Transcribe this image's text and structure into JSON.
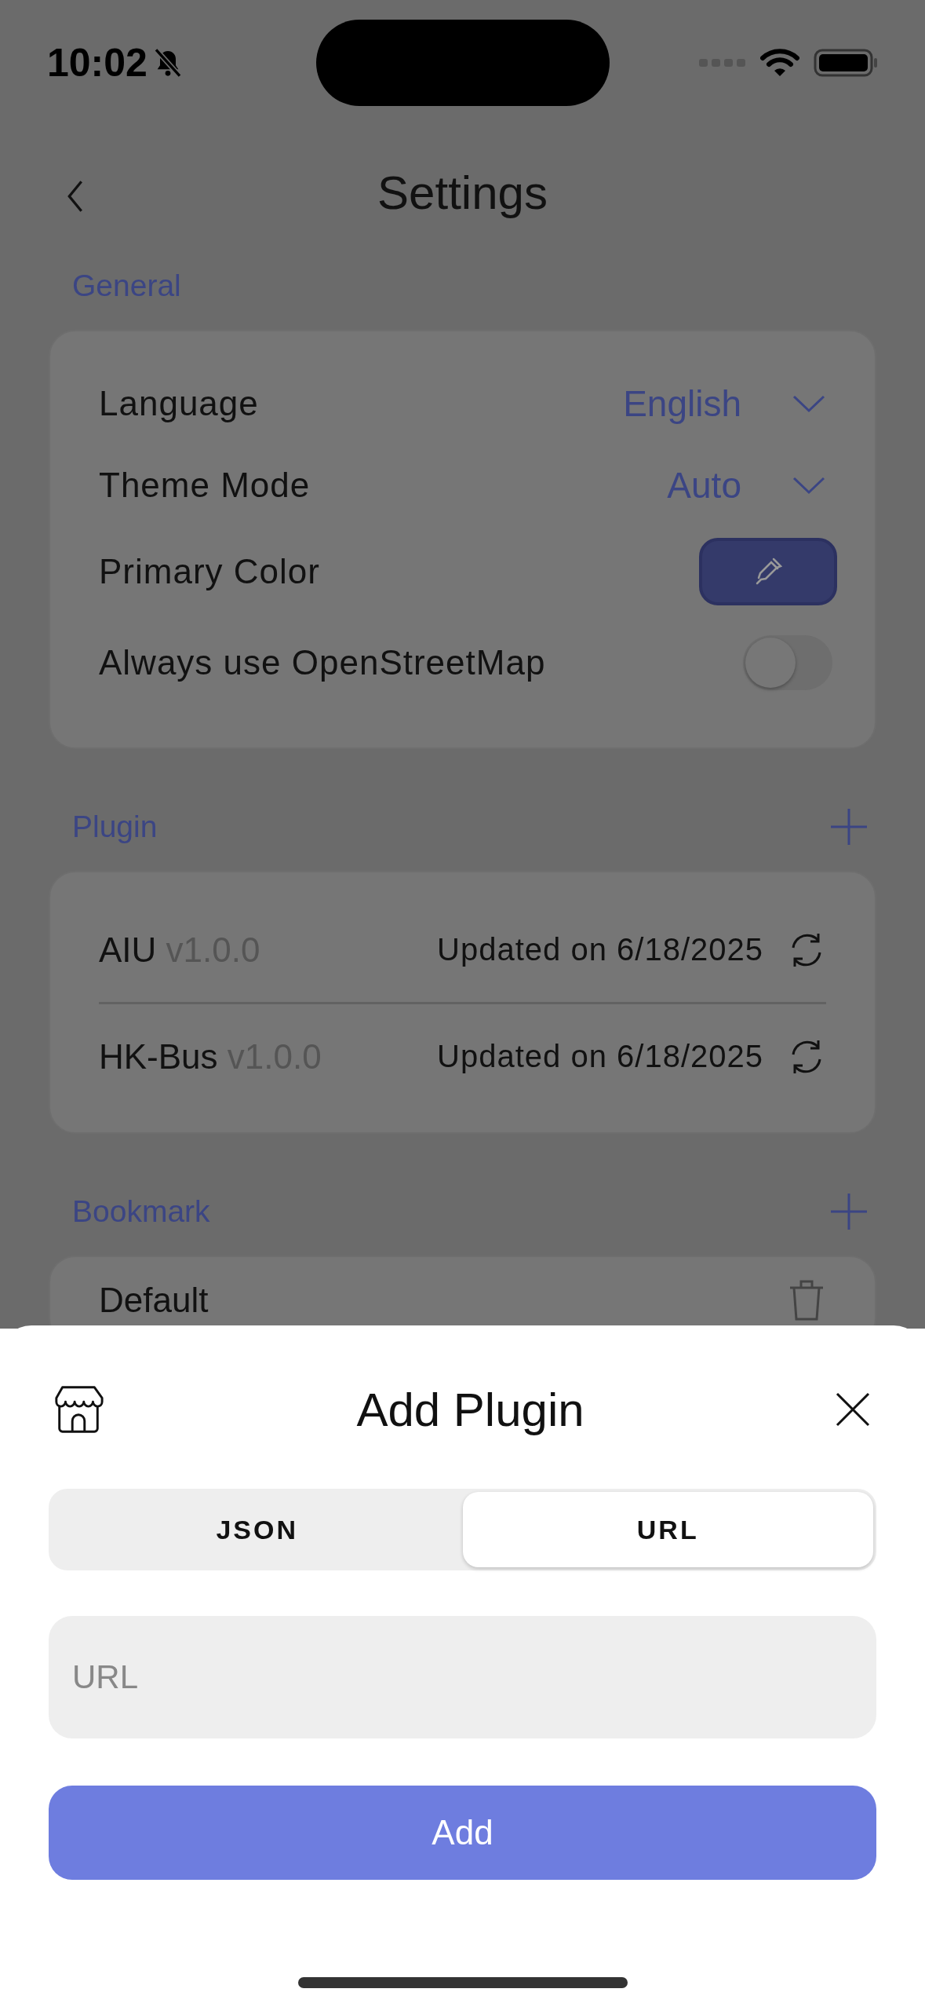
{
  "status_bar": {
    "time": "10:02"
  },
  "header": {
    "title": "Settings"
  },
  "general": {
    "label": "General",
    "rows": [
      {
        "kind": "select",
        "label": "Language",
        "value": "English"
      },
      {
        "kind": "select",
        "label": "Theme Mode",
        "value": "Auto"
      },
      {
        "kind": "color",
        "label": "Primary Color"
      },
      {
        "kind": "toggle",
        "label": "Always use OpenStreetMap",
        "on": false
      }
    ]
  },
  "plugin": {
    "label": "Plugin",
    "items": [
      {
        "name": "AIU",
        "version": "v1.0.0",
        "updated": "Updated on 6/18/2025"
      },
      {
        "name": "HK-Bus",
        "version": "v1.0.0",
        "updated": "Updated on 6/18/2025"
      }
    ]
  },
  "bookmark": {
    "label": "Bookmark",
    "items": [
      {
        "name": "Default"
      }
    ]
  },
  "sheet": {
    "title": "Add Plugin",
    "tabs": [
      {
        "label": "JSON",
        "selected": false
      },
      {
        "label": "URL",
        "selected": true
      }
    ],
    "url_field": {
      "placeholder": "URL"
    },
    "add_button": "Add"
  }
}
